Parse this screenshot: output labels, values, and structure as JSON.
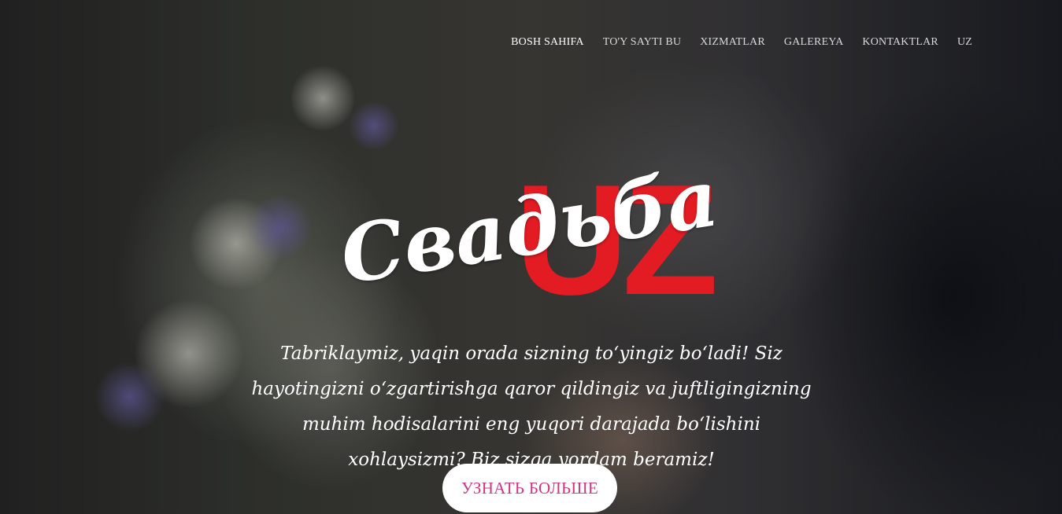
{
  "nav": {
    "items": [
      {
        "label": "BOSH SAHIFA",
        "active": true
      },
      {
        "label": "TO'Y SAYTI BU"
      },
      {
        "label": "XIZMATLAR"
      },
      {
        "label": "GALEREYA"
      },
      {
        "label": "KONTAKTLAR"
      },
      {
        "label": "UZ"
      }
    ]
  },
  "hero": {
    "logo_script": "Свадьба",
    "logo_suffix": "UZ",
    "tagline": "Tabriklaymiz, yaqin orada sizning toʻyingiz boʻladi! Siz hayotingizni oʻzgartirishga qaror qildingiz va juftligingizning muhim hodisalarini eng yuqori darajada boʻlishini xohlaysizmi? Biz sizga yordam beramiz!",
    "cta_label": "УЗНАТЬ БОЛЬШЕ"
  },
  "colors": {
    "accent_red": "#e31b23",
    "cta_text": "#d1357f",
    "nav_text": "#d9d9d9"
  }
}
